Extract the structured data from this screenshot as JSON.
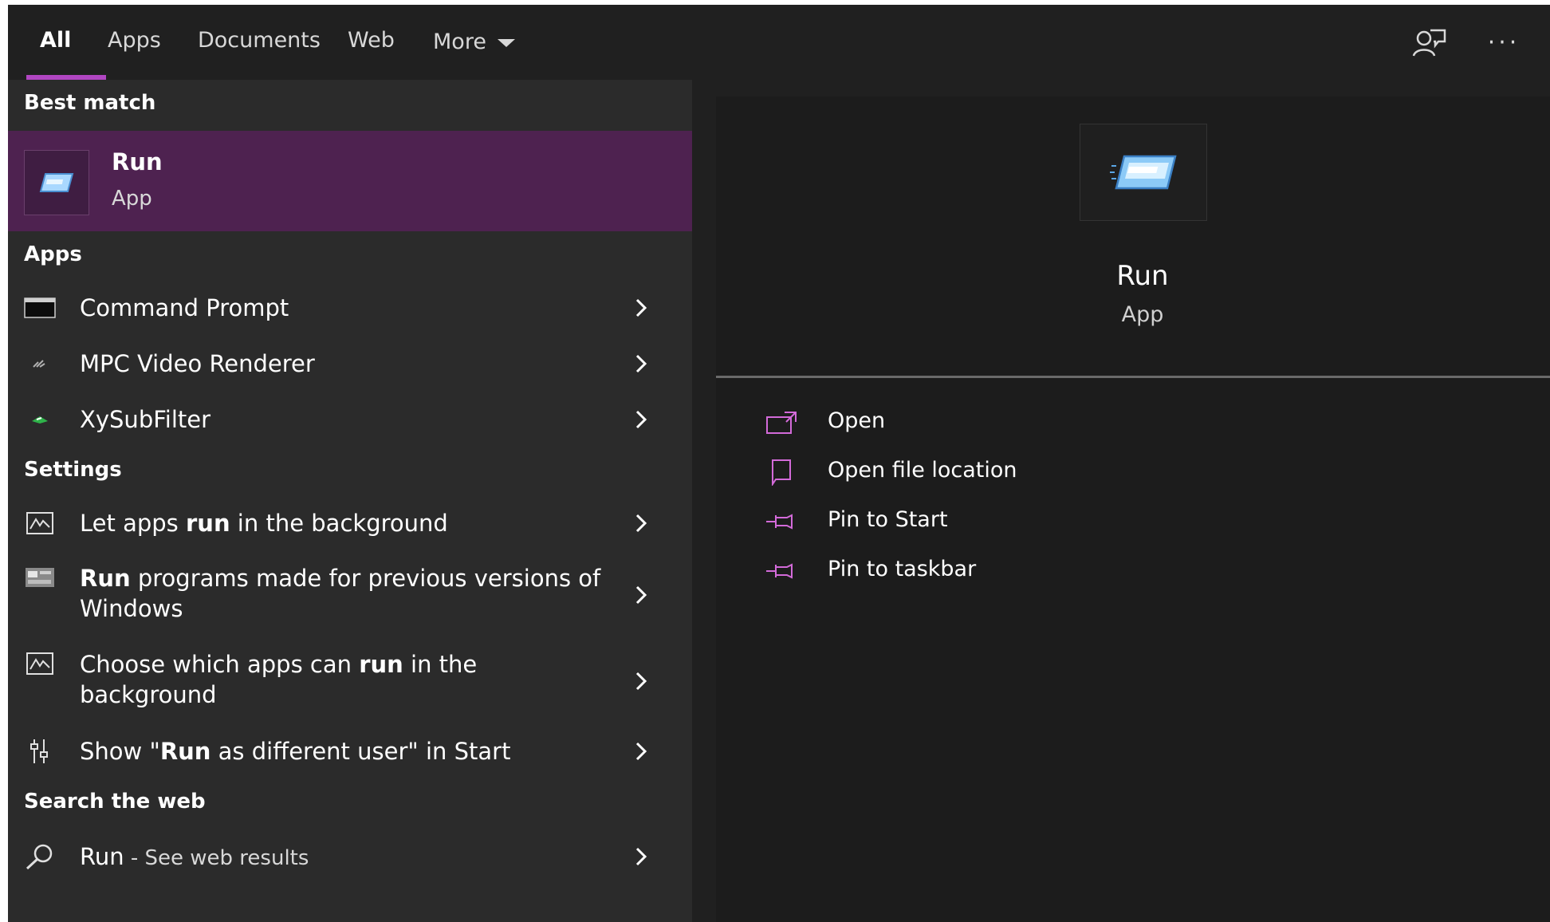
{
  "tabs": [
    {
      "label": "All",
      "active": true
    },
    {
      "label": "Apps"
    },
    {
      "label": "Documents"
    },
    {
      "label": "Web"
    },
    {
      "label": "More"
    }
  ],
  "top_icons": [
    "feedback-icon",
    "more-options-icon"
  ],
  "more_options_glyph": "···",
  "left": {
    "best_match_header": "Best match",
    "best_match": {
      "title": "Run",
      "subtitle": "App"
    },
    "apps_header": "Apps",
    "apps": [
      {
        "label": "Command Prompt",
        "icon": "command-prompt-icon"
      },
      {
        "label": "MPC Video Renderer",
        "icon": "mpc-video-renderer-icon"
      },
      {
        "label": "XySubFilter",
        "icon": "xysubfilter-icon"
      }
    ],
    "settings_header": "Settings",
    "settings": [
      {
        "pre": "Let apps ",
        "bold": "run",
        "post": " in the background",
        "icon": "background-apps-icon"
      },
      {
        "pre": "",
        "bold": "Run",
        "post": " programs made for previous versions of Windows",
        "icon": "compatibility-icon"
      },
      {
        "pre": "Choose which apps can ",
        "bold": "run",
        "post": " in the background",
        "icon": "background-apps-icon"
      },
      {
        "pre": "Show \"",
        "bold": "Run",
        "post": " as different user\" in Start",
        "icon": "settings-sliders-icon"
      }
    ],
    "web_header": "Search the web",
    "web": {
      "label": "Run",
      "suffix": " - See web results",
      "icon": "search-icon"
    }
  },
  "right": {
    "title": "Run",
    "subtitle": "App",
    "actions": [
      {
        "label": "Open",
        "icon": "open-icon"
      },
      {
        "label": "Open file location",
        "icon": "folder-location-icon"
      },
      {
        "label": "Pin to Start",
        "icon": "pin-icon"
      },
      {
        "label": "Pin to taskbar",
        "icon": "pin-icon"
      }
    ]
  },
  "colors": {
    "accent": "#b146c2",
    "selection": "#4e2250",
    "left_bg": "#2b2b2b",
    "right_bg": "#1c1c1c",
    "topbar_bg": "#202020"
  }
}
